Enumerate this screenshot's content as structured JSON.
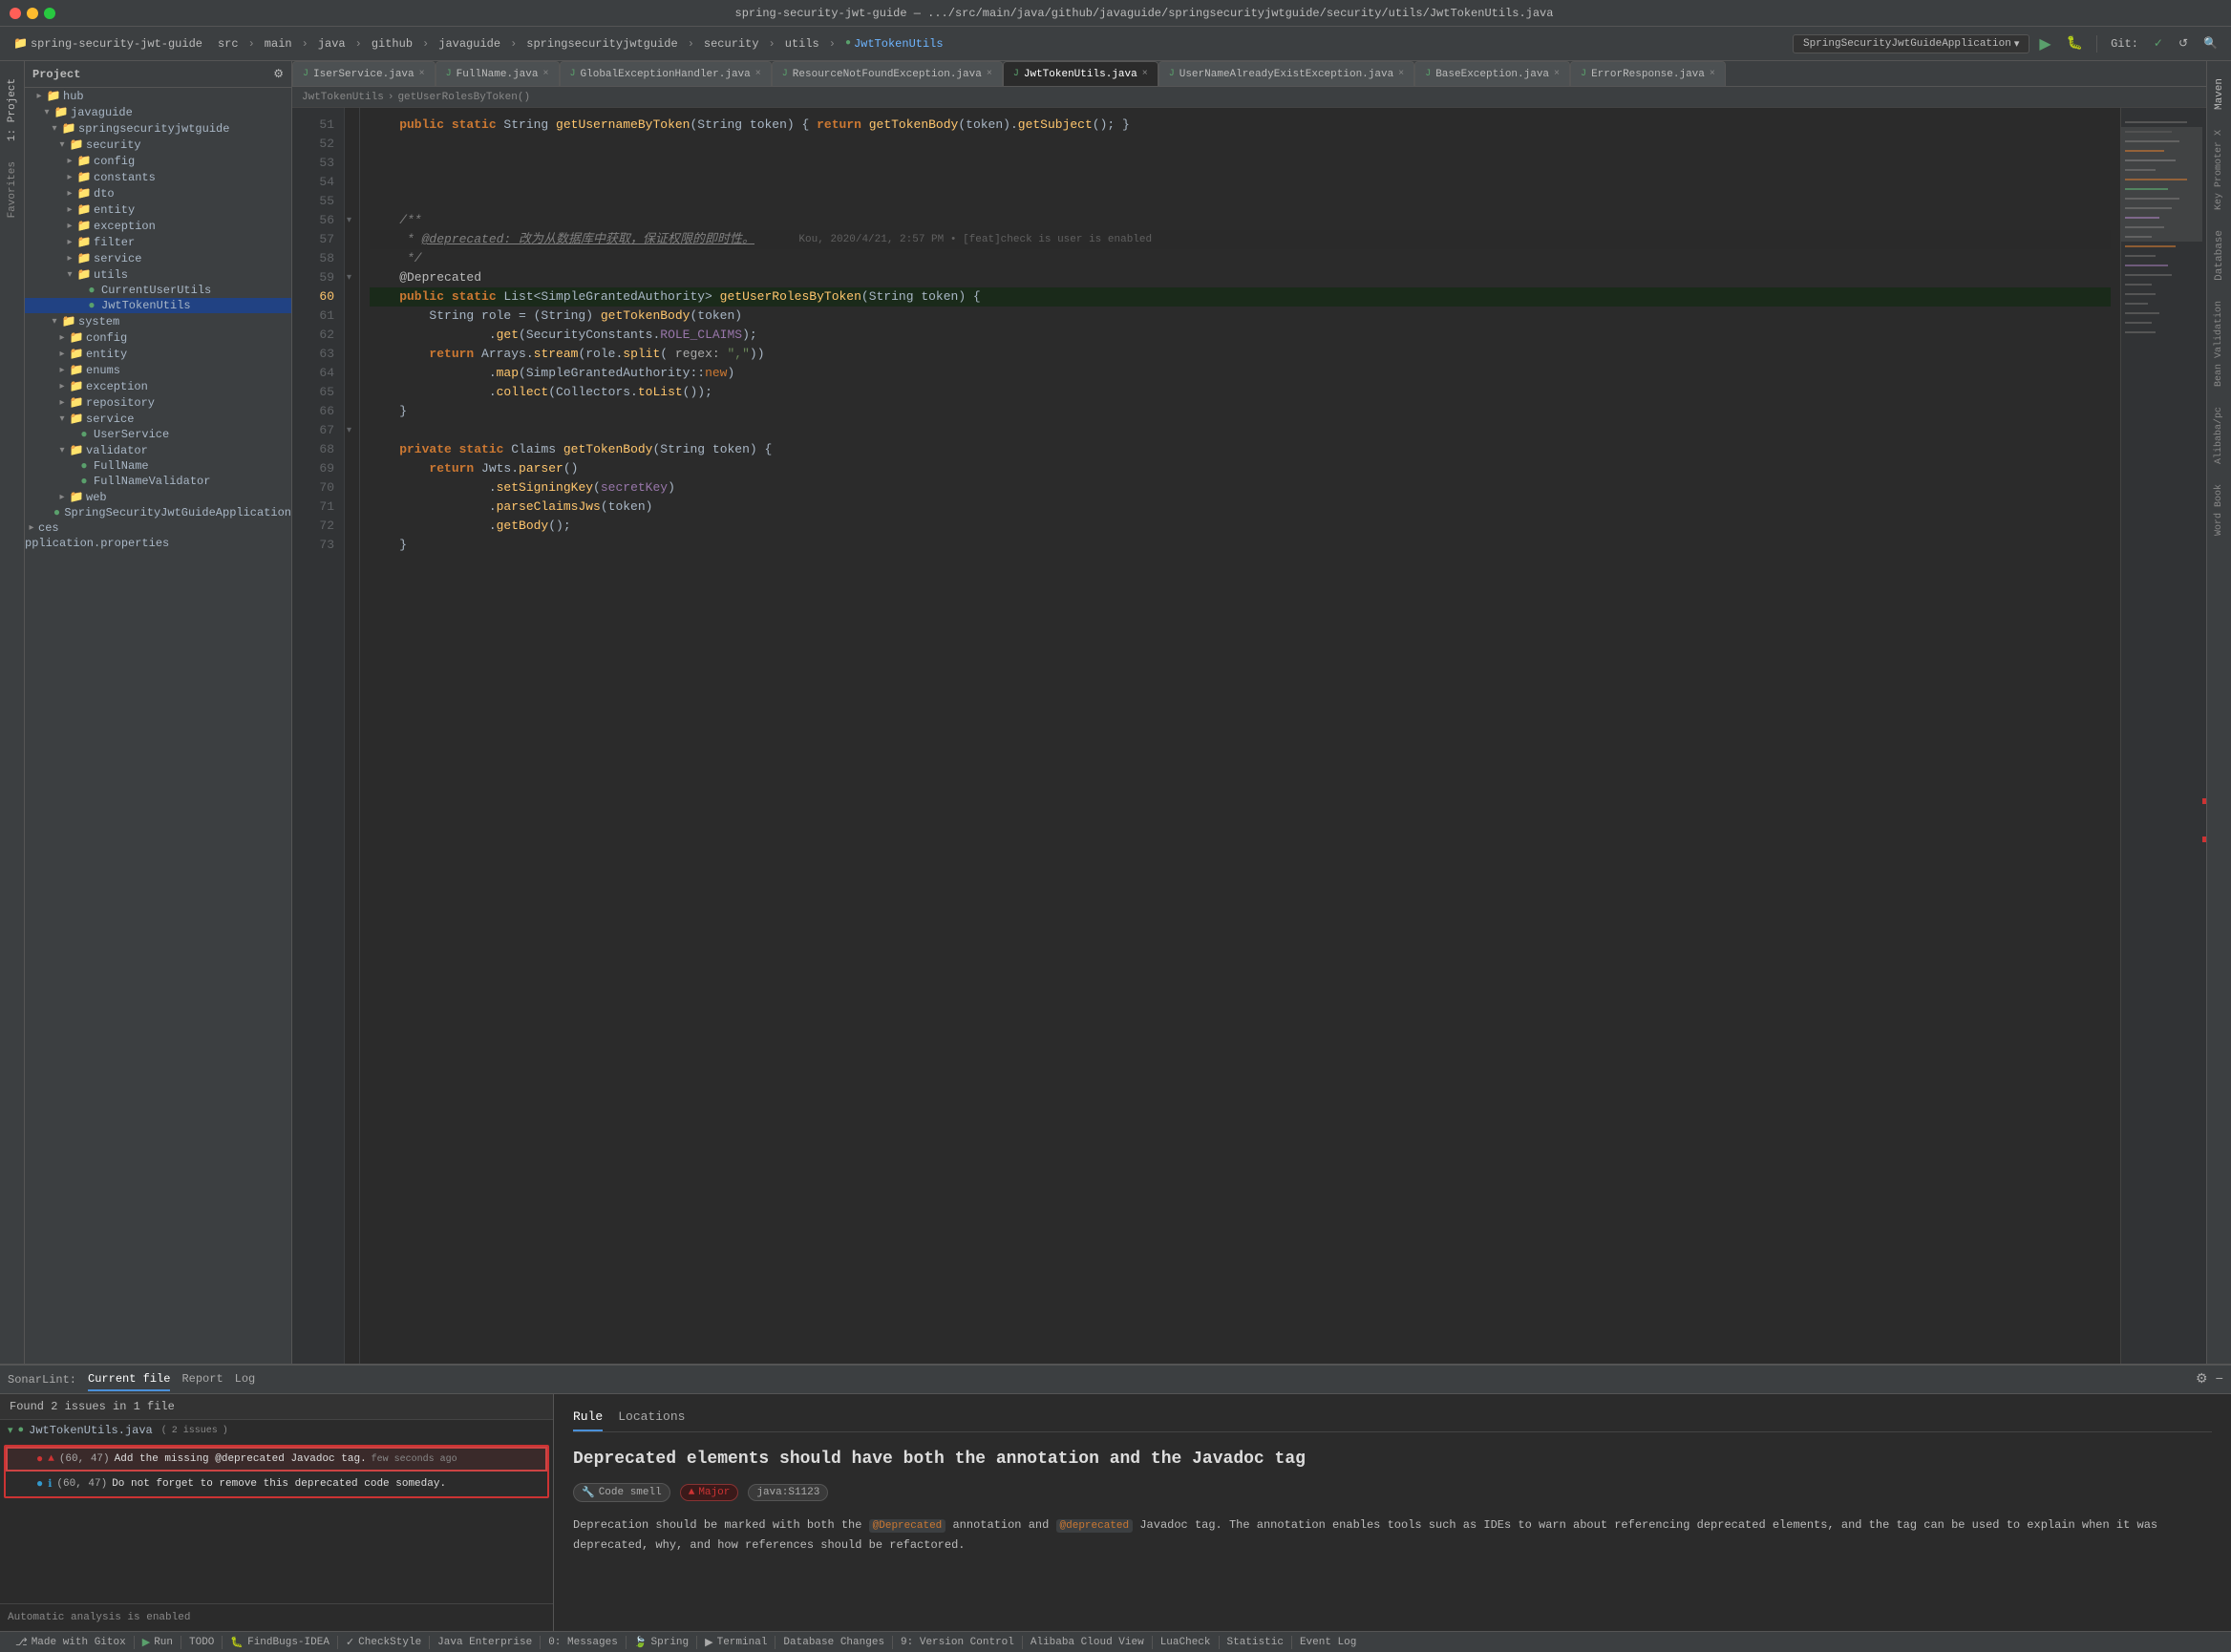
{
  "titleBar": {
    "title": "spring-security-jwt-guide — .../src/main/java/github/javaguide/springsecurityjwtguide/security/utils/JwtTokenUtils.java"
  },
  "toolbar": {
    "projectLabel": "spring-security-jwt-guide",
    "srcLabel": "src",
    "mainLabel": "main",
    "javaLabel": "java",
    "githubLabel": "github",
    "javaguideLabel": "javaguide",
    "springsecurityLabel": "springsecurityjwtguide",
    "securityLabel": "security",
    "utilsLabel": "utils",
    "fileLabel": "JwtTokenUtils",
    "runConfig": "SpringSecurityJwtGuideApplication",
    "dropdownArrow": "▾"
  },
  "fileTabs": [
    {
      "name": "IserService.java",
      "active": false,
      "modified": false
    },
    {
      "name": "FullName.java",
      "active": false,
      "modified": false
    },
    {
      "name": "GlobalExceptionHandler.java",
      "active": false,
      "modified": false
    },
    {
      "name": "ResourceNotFoundException.java",
      "active": false,
      "modified": false
    },
    {
      "name": "JwtTokenUtils.java",
      "active": true,
      "modified": false
    },
    {
      "name": "UserNameAlreadyExistException.java",
      "active": false,
      "modified": false
    },
    {
      "name": "BaseException.java",
      "active": false,
      "modified": false
    },
    {
      "name": "ErrorResponse.java",
      "active": false,
      "modified": false
    }
  ],
  "breadcrumb": {
    "items": [
      "JwtTokenUtils",
      "getUserRolesByToken()"
    ]
  },
  "codeLines": [
    {
      "num": 51,
      "content": "    public static String getUsernameByToken(String token) { return getTokenBody(token).getSubject(); }"
    },
    {
      "num": 52,
      "content": ""
    },
    {
      "num": 53,
      "content": ""
    },
    {
      "num": 54,
      "content": ""
    },
    {
      "num": 55,
      "content": ""
    },
    {
      "num": 56,
      "content": "    /**"
    },
    {
      "num": 57,
      "content": "     * @deprecated: 改为从数据库中获取，保证权限的即时性。    Kou, 2020/4/21, 2:57 PM • [feat]check is user is enabled"
    },
    {
      "num": 58,
      "content": "     */"
    },
    {
      "num": 59,
      "content": "    @Deprecated"
    },
    {
      "num": 60,
      "content": "    public static List<SimpleGrantedAuthority> getUserRolesByToken(String token) {"
    },
    {
      "num": 61,
      "content": "        String role = (String) getTokenBody(token)"
    },
    {
      "num": 62,
      "content": "                .get(SecurityConstants.ROLE_CLAIMS);"
    },
    {
      "num": 63,
      "content": "        return Arrays.stream(role.split( regex: \",\"))"
    },
    {
      "num": 64,
      "content": "                .map(SimpleGrantedAuthority::new)"
    },
    {
      "num": 65,
      "content": "                .collect(Collectors.toList());"
    },
    {
      "num": 66,
      "content": "    }"
    },
    {
      "num": 67,
      "content": ""
    },
    {
      "num": 68,
      "content": "    private static Claims getTokenBody(String token) {"
    },
    {
      "num": 69,
      "content": "        return Jwts.parser()"
    },
    {
      "num": 70,
      "content": "                .setSigningKey(secretKey)"
    },
    {
      "num": 71,
      "content": "                .parseClaimsJws(token)"
    },
    {
      "num": 72,
      "content": "                .getBody();"
    },
    {
      "num": 73,
      "content": "    }"
    }
  ],
  "sidebar": {
    "projectName": "Project",
    "items": [
      {
        "label": "hub",
        "type": "folder",
        "indent": 0,
        "expanded": false
      },
      {
        "label": "javaguide",
        "type": "folder",
        "indent": 1,
        "expanded": true
      },
      {
        "label": "springsecurityjwtguide",
        "type": "folder",
        "indent": 2,
        "expanded": true
      },
      {
        "label": "security",
        "type": "folder",
        "indent": 3,
        "expanded": true
      },
      {
        "label": "config",
        "type": "folder",
        "indent": 4,
        "expanded": false
      },
      {
        "label": "constants",
        "type": "folder",
        "indent": 4,
        "expanded": false
      },
      {
        "label": "dto",
        "type": "folder",
        "indent": 4,
        "expanded": false
      },
      {
        "label": "entity",
        "type": "folder",
        "indent": 4,
        "expanded": false
      },
      {
        "label": "exception",
        "type": "folder",
        "indent": 4,
        "expanded": false
      },
      {
        "label": "filter",
        "type": "folder",
        "indent": 4,
        "expanded": false
      },
      {
        "label": "service",
        "type": "folder",
        "indent": 4,
        "expanded": false
      },
      {
        "label": "utils",
        "type": "folder",
        "indent": 4,
        "expanded": true
      },
      {
        "label": "CurrentUserUtils",
        "type": "java",
        "indent": 5,
        "expanded": false
      },
      {
        "label": "JwtTokenUtils",
        "type": "java",
        "indent": 5,
        "expanded": false,
        "selected": true
      },
      {
        "label": "system",
        "type": "folder",
        "indent": 2,
        "expanded": true
      },
      {
        "label": "config",
        "type": "folder",
        "indent": 3,
        "expanded": false
      },
      {
        "label": "entity",
        "type": "folder",
        "indent": 3,
        "expanded": false
      },
      {
        "label": "enums",
        "type": "folder",
        "indent": 3,
        "expanded": false
      },
      {
        "label": "exception",
        "type": "folder",
        "indent": 3,
        "expanded": false
      },
      {
        "label": "repository",
        "type": "folder",
        "indent": 3,
        "expanded": false
      },
      {
        "label": "service",
        "type": "folder",
        "indent": 3,
        "expanded": true
      },
      {
        "label": "UserService",
        "type": "java",
        "indent": 4,
        "expanded": false
      },
      {
        "label": "validator",
        "type": "folder",
        "indent": 3,
        "expanded": true
      },
      {
        "label": "FullName",
        "type": "java",
        "indent": 4,
        "expanded": false
      },
      {
        "label": "FullNameValidator",
        "type": "java",
        "indent": 4,
        "expanded": false
      },
      {
        "label": "web",
        "type": "folder",
        "indent": 3,
        "expanded": false
      },
      {
        "label": "SpringSecurityJwtGuideApplication",
        "type": "java",
        "indent": 3,
        "expanded": false
      },
      {
        "label": "ces",
        "type": "folder",
        "indent": 0,
        "expanded": false
      },
      {
        "label": "pplication.properties",
        "type": "properties",
        "indent": 0,
        "expanded": false
      }
    ]
  },
  "sonarLint": {
    "tabLabels": [
      "Current file",
      "Report",
      "Log"
    ],
    "activeTab": "Current file",
    "issuesHeader": "Found 2 issues in 1 file",
    "fileName": "JwtTokenUtils.java",
    "fileIssueCount": "2 issues",
    "issues": [
      {
        "pos": "(60, 47)",
        "text": "Add the missing @deprecated Javadoc tag.",
        "time": "few seconds ago",
        "icon": "error"
      },
      {
        "pos": "(60, 47)",
        "text": "Do not forget to remove this deprecated code someday.",
        "time": "",
        "icon": "info"
      }
    ],
    "ruleTabLabels": [
      "Rule",
      "Locations"
    ],
    "activeRuleTab": "Rule",
    "ruleTitle": "Deprecated elements should have both the annotation and the Javadoc tag",
    "ruleMeta": {
      "smell": "Code smell",
      "severity": "Major",
      "code": "java:S1123"
    },
    "ruleBody": "Deprecation should be marked with both the @Deprecated annotation and @deprecated Javadoc tag. The annotation enables tools such as IDEs to warn about referencing deprecated elements, and the tag can be used to explain when it was deprecated, why, and how references should be refactored."
  },
  "statusBar": {
    "gitIcon": "⎇",
    "gitBranch": "Made with Gitox",
    "runLabel": "Run",
    "todoLabel": "TODO",
    "findBugsLabel": "FindBugs-IDEA",
    "checkStyleLabel": "CheckStyle",
    "javaEnterpriseLabel": "Java Enterprise",
    "messagesLabel": "0: Messages",
    "springLabel": "Spring",
    "terminalLabel": "Terminal",
    "dbChangesLabel": "Database Changes",
    "versionControlLabel": "9: Version Control",
    "alibabaLabel": "Alibaba Cloud View",
    "luaCheckLabel": "LuaCheck",
    "statisticLabel": "Statistic",
    "eventLogLabel": "Event Log",
    "analysisStatus": "Automatic analysis is enabled"
  },
  "icons": {
    "folderExpanded": "▾",
    "folderCollapsed": "▸",
    "javaFile": "●",
    "close": "×",
    "settings": "⚙",
    "minus": "−",
    "errorDot": "●",
    "infoDot": "ℹ",
    "chevronRight": "›"
  }
}
